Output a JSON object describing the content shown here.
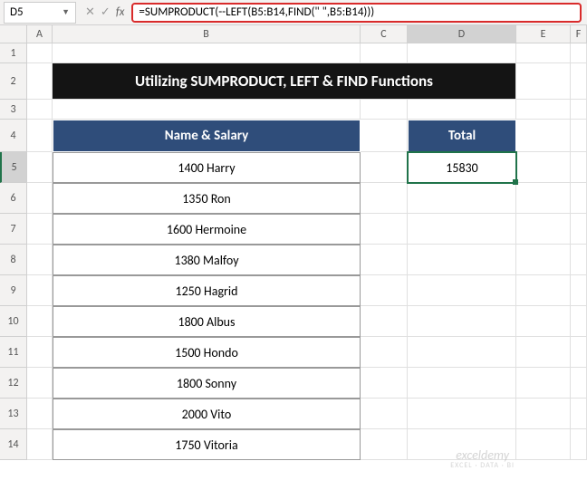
{
  "namebox": {
    "value": "D5"
  },
  "formula": {
    "value": "=SUMPRODUCT(--LEFT(B5:B14,FIND(\" \",B5:B14)))"
  },
  "columns": [
    "A",
    "B",
    "C",
    "D",
    "E",
    "F"
  ],
  "rows": [
    "1",
    "2",
    "3",
    "4",
    "5",
    "6",
    "7",
    "8",
    "9",
    "10",
    "11",
    "12",
    "13",
    "14"
  ],
  "title": "Utilizing SUMPRODUCT, LEFT & FIND Functions",
  "header_b": "Name & Salary",
  "header_d": "Total",
  "total_value": "15830",
  "data_rows": [
    "1400 Harry",
    "1350 Ron",
    "1600 Hermoine",
    "1380 Malfoy",
    "1250 Hagrid",
    "1800 Albus",
    "1500 Hondo",
    "1800 Sonny",
    "2000 Vito",
    "1750 Vitoria"
  ],
  "watermark": {
    "main": "exceldemy",
    "sub": "EXCEL · DATA · BI"
  }
}
